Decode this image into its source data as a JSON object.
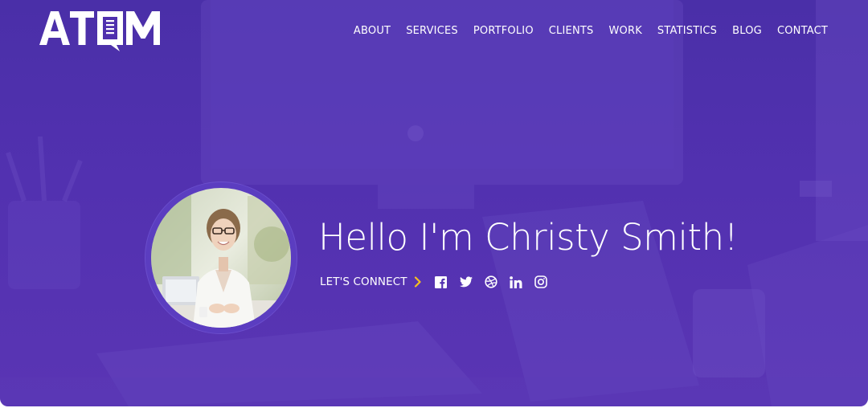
{
  "brand": {
    "logo_text": "ATQM"
  },
  "nav": {
    "items": [
      {
        "label": "ABOUT"
      },
      {
        "label": "SERVICES"
      },
      {
        "label": "PORTFOLIO"
      },
      {
        "label": "CLIENTS"
      },
      {
        "label": "WORK"
      },
      {
        "label": "STATISTICS"
      },
      {
        "label": "BLOG"
      },
      {
        "label": "CONTACT"
      }
    ]
  },
  "hero": {
    "headline": "Hello I'm Christy Smith!",
    "connect_label": "LET'S CONNECT",
    "social": [
      {
        "icon": "facebook-icon"
      },
      {
        "icon": "twitter-icon"
      },
      {
        "icon": "dribbble-icon"
      },
      {
        "icon": "linkedin-icon"
      },
      {
        "icon": "instagram-icon"
      }
    ]
  },
  "colors": {
    "background": "#5231b0",
    "text": "#ffffff",
    "accent": "#f6c01e"
  }
}
